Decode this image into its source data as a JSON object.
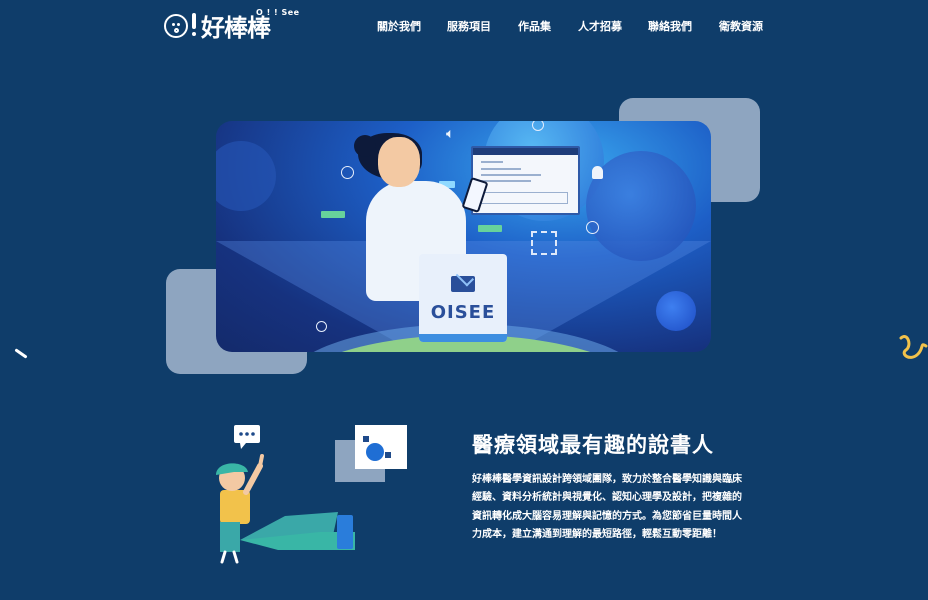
{
  "header": {
    "logo_sub": "O ! ! See",
    "logo_name": "好棒棒",
    "nav": [
      {
        "label": "關於我們"
      },
      {
        "label": "服務項目"
      },
      {
        "label": "作品集"
      },
      {
        "label": "人才招募"
      },
      {
        "label": "聯絡我們"
      },
      {
        "label": "衛教資源"
      }
    ]
  },
  "hero": {
    "podium_label": "OISEE",
    "icons": [
      "speaker-icon",
      "bell-icon",
      "mail-icon",
      "frame-brackets-icon"
    ]
  },
  "intro": {
    "title": "醫療領域最有趣的說書人",
    "body": "好棒棒醫學資訊設計跨領域團隊，致力於整合醫學知識與臨床經驗、資料分析統計與視覺化、認知心理學及設計，把複雜的資訊轉化成大腦容易理解與記憶的方式。為您節省巨量時間人力成本，建立溝通到理解的最短路徑，輕鬆互動零距離！"
  },
  "colors": {
    "background": "#0f3d6a",
    "accent_card": "#8ea5c0",
    "hero_blue": "#1d5fc7",
    "green": "#67d29b",
    "yellow": "#f2c24b"
  }
}
